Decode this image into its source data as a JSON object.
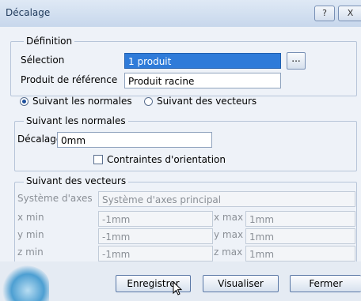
{
  "window": {
    "title": "Décalage",
    "help_label": "?",
    "close_label": "X"
  },
  "definition": {
    "legend": "Définition",
    "selection_label": "Sélection",
    "selection_value": "1 produit",
    "browse_label": "...",
    "ref_product_label": "Produit de référence",
    "ref_product_value": "Produit racine"
  },
  "mode": {
    "normals_label": "Suivant les normales",
    "normals_selected": true,
    "vectors_label": "Suivant des vecteurs",
    "vectors_selected": false
  },
  "normals": {
    "legend": "Suivant les normales",
    "offset_label": "Décalage",
    "offset_value": "0mm",
    "orientation_label": "Contraintes d'orientation",
    "orientation_checked": false
  },
  "vectors": {
    "legend": "Suivant des vecteurs",
    "axis_label": "Système d'axes",
    "axis_value": "Système d'axes principal",
    "rows": [
      {
        "min_label": "x min",
        "min_value": "-1mm",
        "max_label": "x max",
        "max_value": "1mm"
      },
      {
        "min_label": "y min",
        "min_value": "-1mm",
        "max_label": "y max",
        "max_value": "1mm"
      },
      {
        "min_label": "z min",
        "min_value": "-1mm",
        "max_label": "z max",
        "max_value": "1mm"
      }
    ]
  },
  "buttons": {
    "save": "Enregistrer",
    "preview": "Visualiser",
    "close": "Fermer"
  }
}
